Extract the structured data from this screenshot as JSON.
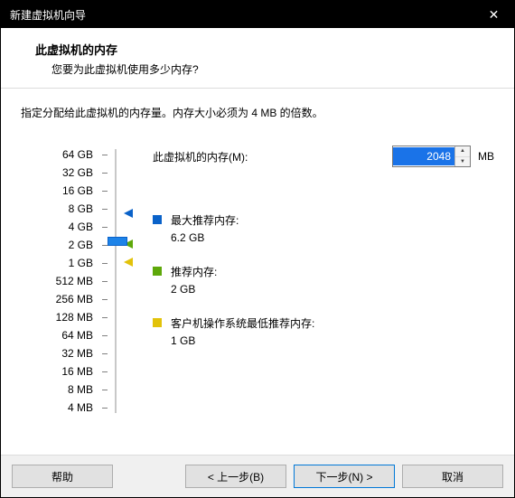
{
  "window": {
    "title": "新建虚拟机向导"
  },
  "header": {
    "title": "此虚拟机的内存",
    "subtitle": "您要为此虚拟机使用多少内存?"
  },
  "instruction": "指定分配给此虚拟机的内存量。内存大小必须为 4 MB 的倍数。",
  "memory": {
    "label": "此虚拟机的内存(M):",
    "value": "2048",
    "unit": "MB"
  },
  "ticks": [
    "64 GB",
    "32 GB",
    "16 GB",
    "8 GB",
    "4 GB",
    "2 GB",
    "1 GB",
    "512 MB",
    "256 MB",
    "128 MB",
    "64 MB",
    "32 MB",
    "16 MB",
    "8 MB",
    "4 MB"
  ],
  "reco": {
    "max": {
      "label": "最大推荐内存:",
      "value": "6.2 GB"
    },
    "rec": {
      "label": "推荐内存:",
      "value": "2 GB"
    },
    "min": {
      "label": "客户机操作系统最低推荐内存:",
      "value": "1 GB"
    }
  },
  "buttons": {
    "help": "帮助",
    "back": "< 上一步(B)",
    "next": "下一步(N) >",
    "cancel": "取消"
  },
  "icons": {
    "close": "✕",
    "up": "▲",
    "down": "▼"
  }
}
